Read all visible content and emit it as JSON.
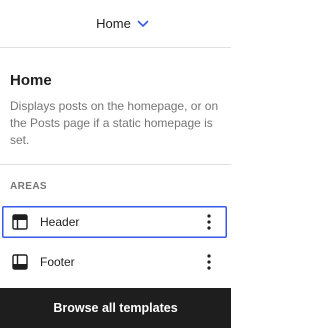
{
  "topbar": {
    "title": "Home",
    "chevron_icon": "chevron-down-icon",
    "accent_color": "#3858e9"
  },
  "template": {
    "title": "Home",
    "description": "Displays posts on the homepage, or on the Posts page if a static homepage is set."
  },
  "areas": {
    "heading": "AREAS",
    "items": [
      {
        "label": "Header",
        "icon": "header-layout-icon",
        "selected": true
      },
      {
        "label": "Footer",
        "icon": "footer-layout-icon",
        "selected": false
      }
    ],
    "more_icon": "more-vertical-icon",
    "selection_color": "#3858e9"
  },
  "footer": {
    "browse_label": "Browse all templates",
    "background": "#1e1e1e"
  }
}
